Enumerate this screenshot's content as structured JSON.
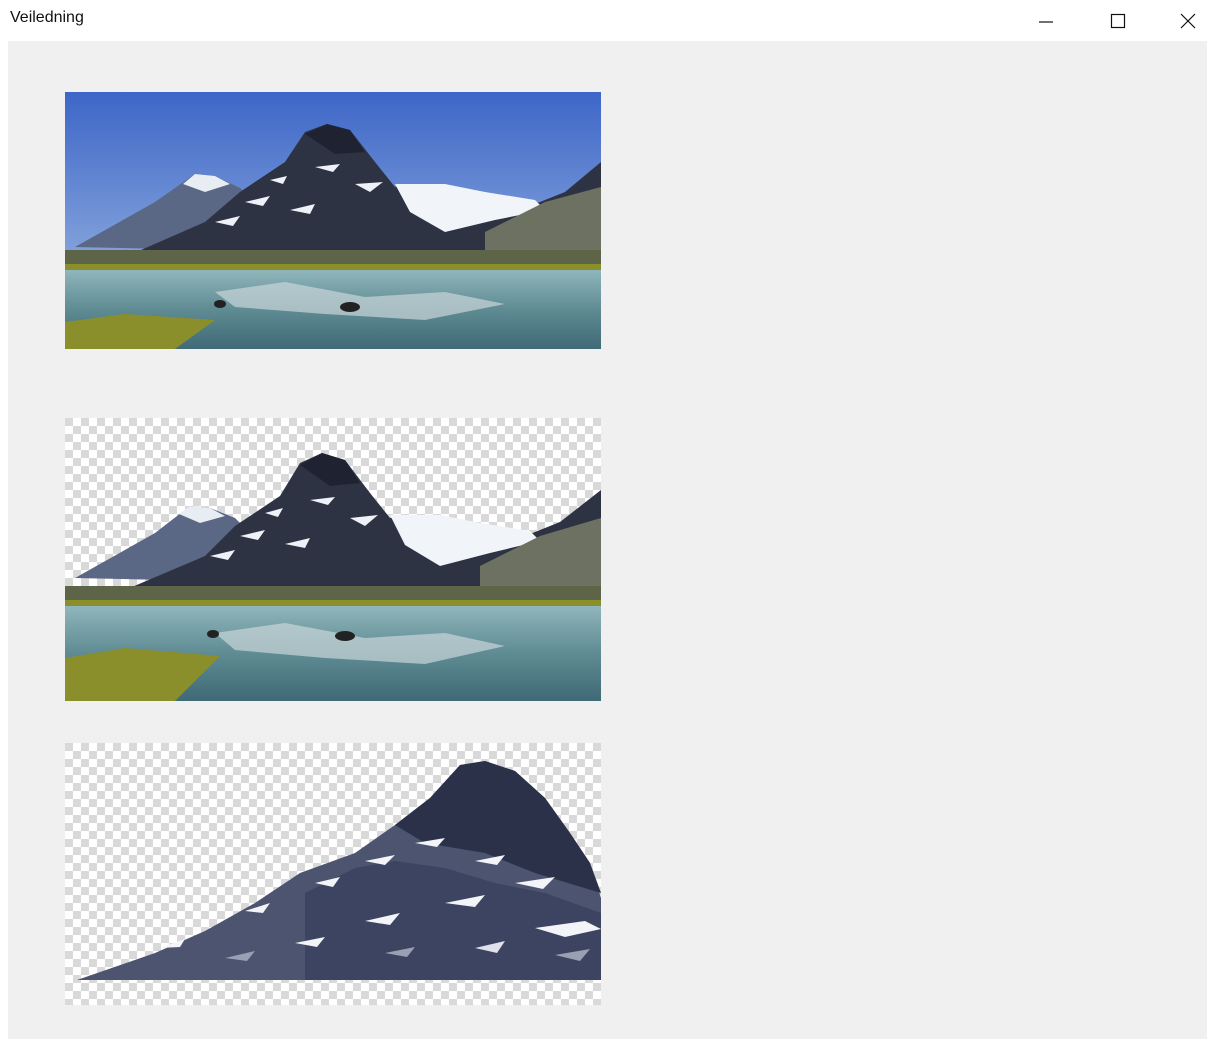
{
  "window": {
    "title": "Veiledning",
    "controls": {
      "minimize_icon": "minimize-icon",
      "maximize_icon": "maximize-icon",
      "close_icon": "close-icon"
    }
  },
  "colors": {
    "client_background": "#f0f0f0",
    "titlebar_background": "#ffffff",
    "sky_top": "#3d66c7",
    "sky_bottom": "#a9c2e6",
    "mountain_dark": "#2a2f3e",
    "snow": "#f2f4f8",
    "water": "#7ea6ad",
    "grass": "#8a8f2c",
    "checker_light": "#ffffff",
    "checker_dark": "#d9d9d9",
    "vector_dark": "#2b3148",
    "vector_mid": "#4c5470"
  },
  "images": [
    {
      "name": "mountain-lake-photo",
      "description_icon": "photo-icon"
    },
    {
      "name": "mountain-lake-sky-removed",
      "description_icon": "photo-icon"
    },
    {
      "name": "mountain-vector-isolated",
      "description_icon": "photo-icon"
    }
  ]
}
